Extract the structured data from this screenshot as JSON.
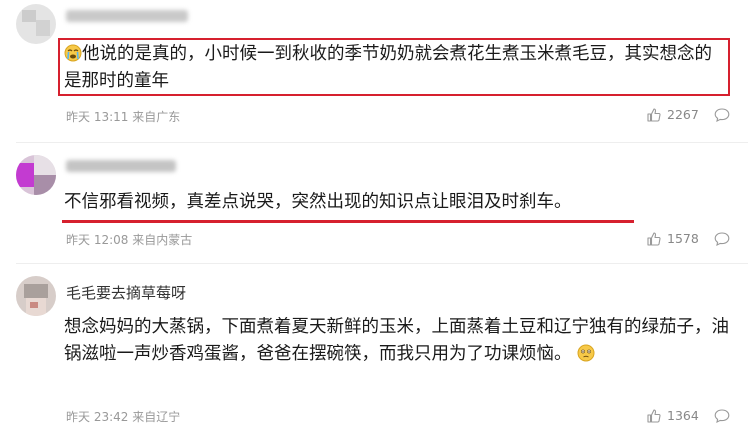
{
  "comments": [
    {
      "username": "",
      "text": "他说的是真的，小时候一到秋收的季节奶奶就会煮花生煮玉米煮毛豆，其实想念的是那时的童年",
      "meta": "昨天 13:11 来自广东",
      "likes": "2267",
      "emoji": "crying-face"
    },
    {
      "username": "",
      "text": "不信邪看视频，真差点说哭，突然出现的知识点让眼泪及时刹车。",
      "meta": "昨天 12:08 来自内蒙古",
      "likes": "1578"
    },
    {
      "username": "毛毛要去摘草莓呀",
      "text": "想念妈妈的大蒸锅，下面煮着夏天新鲜的玉米，上面蒸着土豆和辽宁独有的绿茄子，油锅滋啦一声炒香鸡蛋酱，爸爸在摆碗筷，而我只用为了功课烦恼。",
      "meta": "昨天 23:42 来自辽宁",
      "likes": "1364",
      "emoji": "tearful-face"
    }
  ],
  "colors": {
    "highlight": "#d6202e",
    "meta": "#999999"
  },
  "icons": {
    "like": "thumbs-up-icon",
    "reply": "comment-bubble-icon"
  }
}
